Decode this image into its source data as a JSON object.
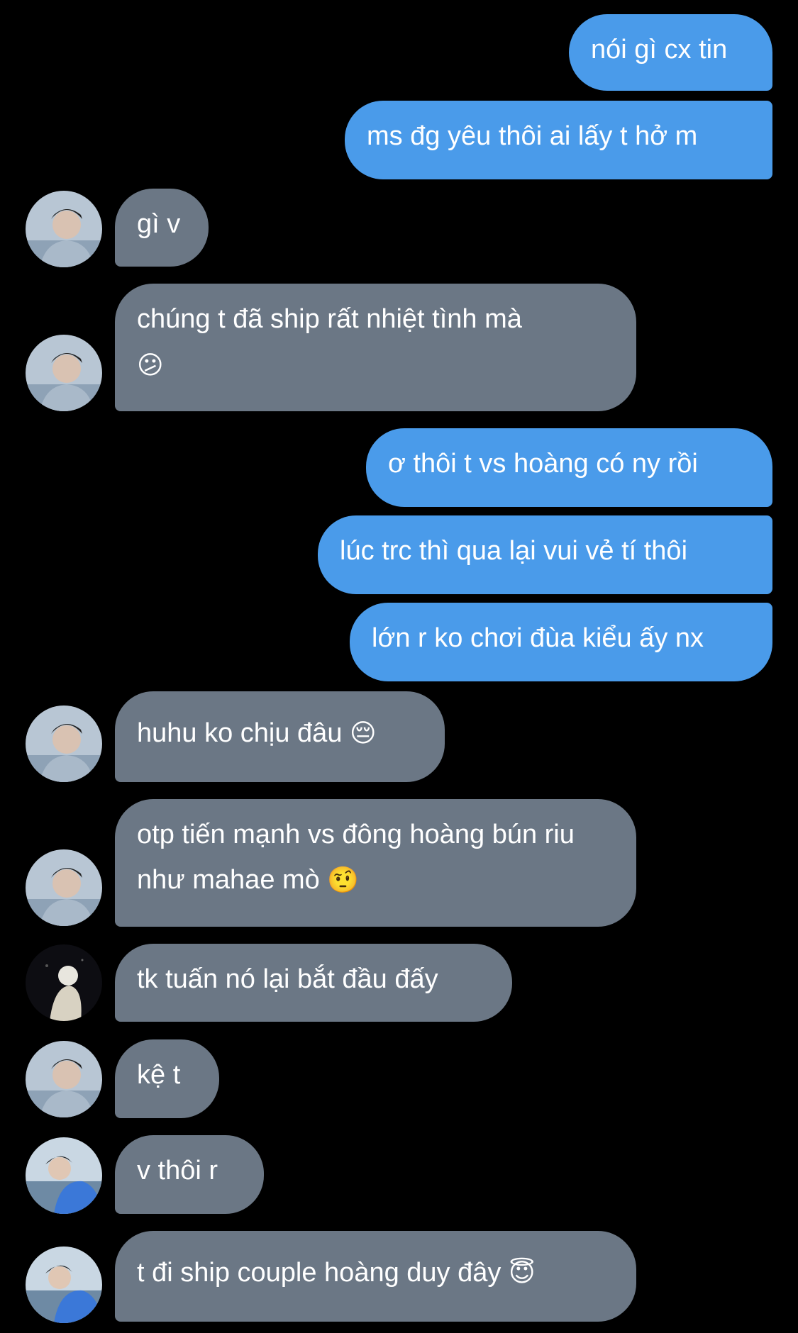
{
  "colors": {
    "background": "#000000",
    "outgoing_bubble": "#4a9bea",
    "incoming_bubble": "#6b7785",
    "text": "#ffffff"
  },
  "messages": [
    {
      "direction": "outgoing",
      "text": "nói gì cx tin"
    },
    {
      "direction": "outgoing",
      "text": "ms đg yêu thôi ai lấy t hở m"
    },
    {
      "direction": "incoming",
      "sender": "avatar-1",
      "text": "gì v"
    },
    {
      "direction": "incoming",
      "sender": "avatar-1",
      "text": "chúng t đã ship rất nhiệt tình mà",
      "emoji": "😕"
    },
    {
      "direction": "outgoing",
      "text": "ơ thôi t vs hoàng có ny rồi"
    },
    {
      "direction": "outgoing",
      "text": "lúc trc thì qua lại vui vẻ tí thôi"
    },
    {
      "direction": "outgoing",
      "text": "lớn r ko chơi đùa kiểu ấy nx"
    },
    {
      "direction": "incoming",
      "sender": "avatar-1",
      "text": "huhu ko chịu đâu",
      "emoji": "😔"
    },
    {
      "direction": "incoming",
      "sender": "avatar-1",
      "text": "otp tiến mạnh vs đông hoàng bún riu như mahae mò",
      "emoji": "🤨"
    },
    {
      "direction": "incoming",
      "sender": "avatar-2",
      "text": "tk tuấn nó lại bắt đầu đấy"
    },
    {
      "direction": "incoming",
      "sender": "avatar-1",
      "text": "kệ t"
    },
    {
      "direction": "incoming",
      "sender": "avatar-3",
      "text": "v thôi r"
    },
    {
      "direction": "incoming",
      "sender": "avatar-3",
      "text": "t đi ship couple hoàng duy đây",
      "emoji": "😇"
    }
  ]
}
